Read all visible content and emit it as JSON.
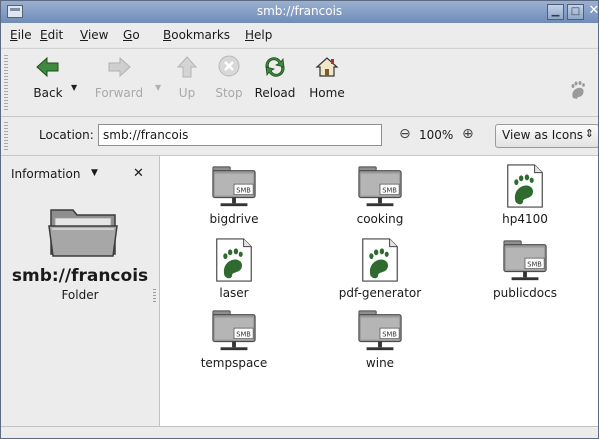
{
  "window": {
    "title": "smb://francois"
  },
  "menubar": [
    {
      "key": "E",
      "rest": "ile"
    },
    {
      "key": "E",
      "rest": "dit"
    },
    {
      "key": "V",
      "rest": "iew"
    },
    {
      "key": "G",
      "rest": "o"
    },
    {
      "key": "B",
      "rest": "ookmarks"
    },
    {
      "key": "H",
      "rest": "elp"
    }
  ],
  "toolbar": {
    "back": "Back",
    "forward": "Forward",
    "up": "Up",
    "stop": "Stop",
    "reload": "Reload",
    "home": "Home"
  },
  "location": {
    "label": "Location:",
    "value": "smb://francois",
    "zoom": "100%",
    "view_as": "View as Icons"
  },
  "sidepane": {
    "title": "Information",
    "name": "smb://francois",
    "type": "Folder"
  },
  "icons": [
    {
      "name": "bigdrive",
      "kind": "smb-share-icon"
    },
    {
      "name": "cooking",
      "kind": "smb-share-icon"
    },
    {
      "name": "hp4100",
      "kind": "printer-foot-icon"
    },
    {
      "name": "laser",
      "kind": "printer-foot-icon"
    },
    {
      "name": "pdf-generator",
      "kind": "printer-foot-icon"
    },
    {
      "name": "publicdocs",
      "kind": "smb-share-icon"
    },
    {
      "name": "tempspace",
      "kind": "smb-share-icon"
    },
    {
      "name": "wine",
      "kind": "smb-share-icon"
    }
  ],
  "colors": {
    "titlebar": "#7f9ac2",
    "foot_green": "#2f6b2f"
  }
}
